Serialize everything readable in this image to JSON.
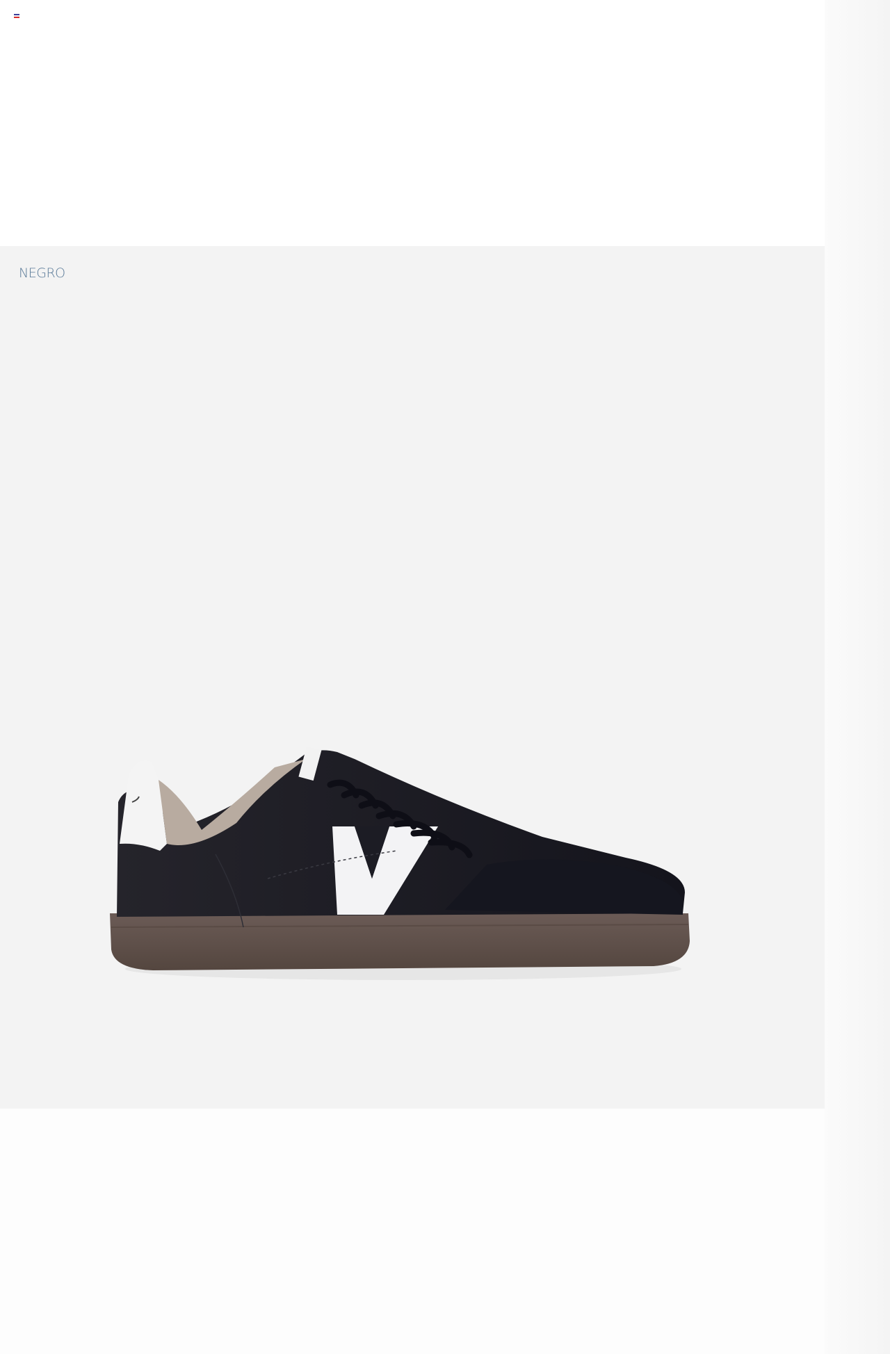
{
  "product": {
    "color_label": "NEGRO"
  },
  "colors": {
    "label_color": "#5a7a98",
    "card_background": "#f3f3f3",
    "flag_top": "#3b3f9b",
    "flag_middle": "#f4f4f4",
    "flag_bottom": "#d62b2b"
  },
  "icons": {
    "language_flag": "flag-icon",
    "product_photo": "sneaker-image"
  }
}
